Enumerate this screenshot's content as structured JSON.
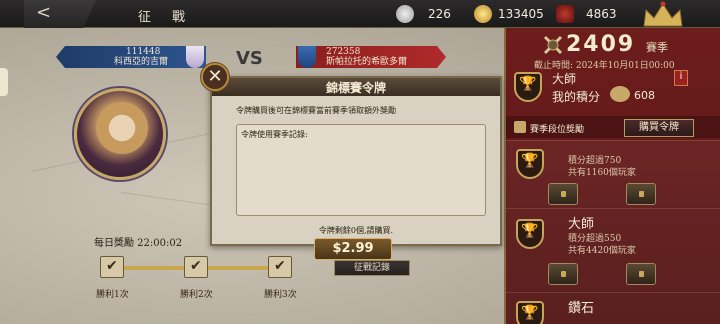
{
  "topbar": {
    "title": "征　戰",
    "back_label": "<",
    "silver": "226",
    "gold": "133405",
    "honor": "4863",
    "icons": {
      "silver": "silver-coin-icon",
      "gold": "gold-coin-icon",
      "honor": "lion-crest-icon",
      "crown": "crown-icon"
    }
  },
  "versus": {
    "left_score": "111448",
    "left_name": "科西亞的吉爾",
    "vs": "VS",
    "right_score": "272358",
    "right_name": "斯帕拉托的希歐多爾"
  },
  "daily": {
    "title": "每日獎勵 22:00:02",
    "wins": [
      "勝利1次",
      "勝利2次",
      "勝利3次"
    ]
  },
  "modal": {
    "title": "錦標賽令牌",
    "description": "令牌購買後可在錦標賽當前賽季領取額外獎勵",
    "record_label": "令牌使用賽季記錄:",
    "remaining": "令牌剩餘0個,請購買.",
    "close": "✕",
    "price": "$2.99",
    "record_button": "征戰記錄"
  },
  "season_panel": {
    "score": "2409",
    "season_label": "賽季",
    "deadline": "截止時間: 2024年10月01日00:00",
    "rank_name": "大師",
    "my_points_label": "我的積分",
    "my_points": "608",
    "info": "i",
    "rewards_label": "賽季段位獎勵",
    "buy_token": "購買令牌",
    "tiers": [
      {
        "name": "",
        "req": "積分超過750",
        "players": "共有1160個玩家"
      },
      {
        "name": "大師",
        "req": "積分超過550",
        "players": "共有4420個玩家"
      },
      {
        "name": "鑽石",
        "req": "",
        "players": ""
      }
    ]
  },
  "colors": {
    "panel": "#6e1d1d",
    "accent": "#c8a868",
    "left_banner": "#2e5590",
    "right_banner": "#b02a2a"
  }
}
